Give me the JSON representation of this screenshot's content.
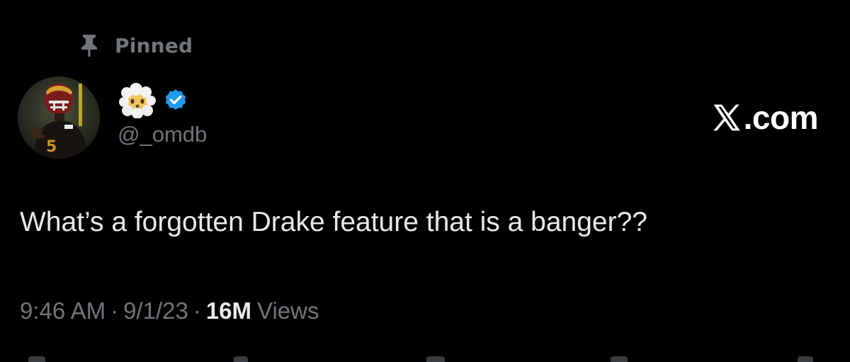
{
  "pinned": {
    "label": "Pinned",
    "icon": "pin-icon"
  },
  "author": {
    "display_name_icon": "face-in-clouds-emoji",
    "verified_icon": "verified-badge-icon",
    "handle": "@_omdb",
    "avatar": "football-player-avatar"
  },
  "watermark": {
    "logo_icon": "x-logo-icon",
    "text": ".com"
  },
  "tweet": {
    "text": "What’s a forgotten Drake feature that is a banger??"
  },
  "meta": {
    "time": "9:46 AM",
    "separator": "·",
    "date": "9/1/23",
    "views_count": "16M",
    "views_label": "Views"
  },
  "colors": {
    "background": "#000000",
    "primary_text": "#e7e9ea",
    "secondary_text": "#71767b",
    "verified_blue": "#1d9bf0"
  }
}
